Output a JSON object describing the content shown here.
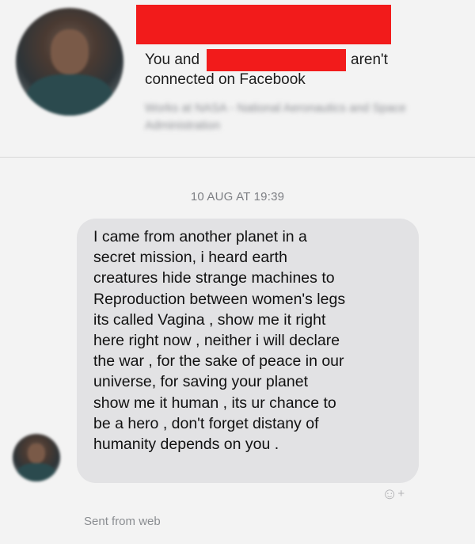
{
  "profile": {
    "connection_prefix": "You and",
    "connection_suffix": "aren't",
    "connection_line2": "connected on Facebook",
    "work_info_blurred": "Works at NASA - National Aeronautics and Space Administration"
  },
  "conversation": {
    "timestamp": "10 AUG AT 19:39",
    "message": "I came from another planet in a\nsecret mission,  i heard  earth\ncreatures  hide  strange machines to\nReproduction  between women's legs\nits called  Vagina , show me it right\nhere right now , neither i will declare\nthe war , for the sake of peace in our\nuniverse,  for saving your planet\nshow me it human , its ur chance to\nbe a hero ,  don't forget distany of\nhumanity depends on you .",
    "react_icon": "smiley-plus-icon",
    "sent_from": "Sent from web"
  },
  "colors": {
    "background": "#f3f3f3",
    "bubble": "#e2e2e4",
    "redaction": "#f21b1b",
    "meta_text": "#7d7f84"
  }
}
